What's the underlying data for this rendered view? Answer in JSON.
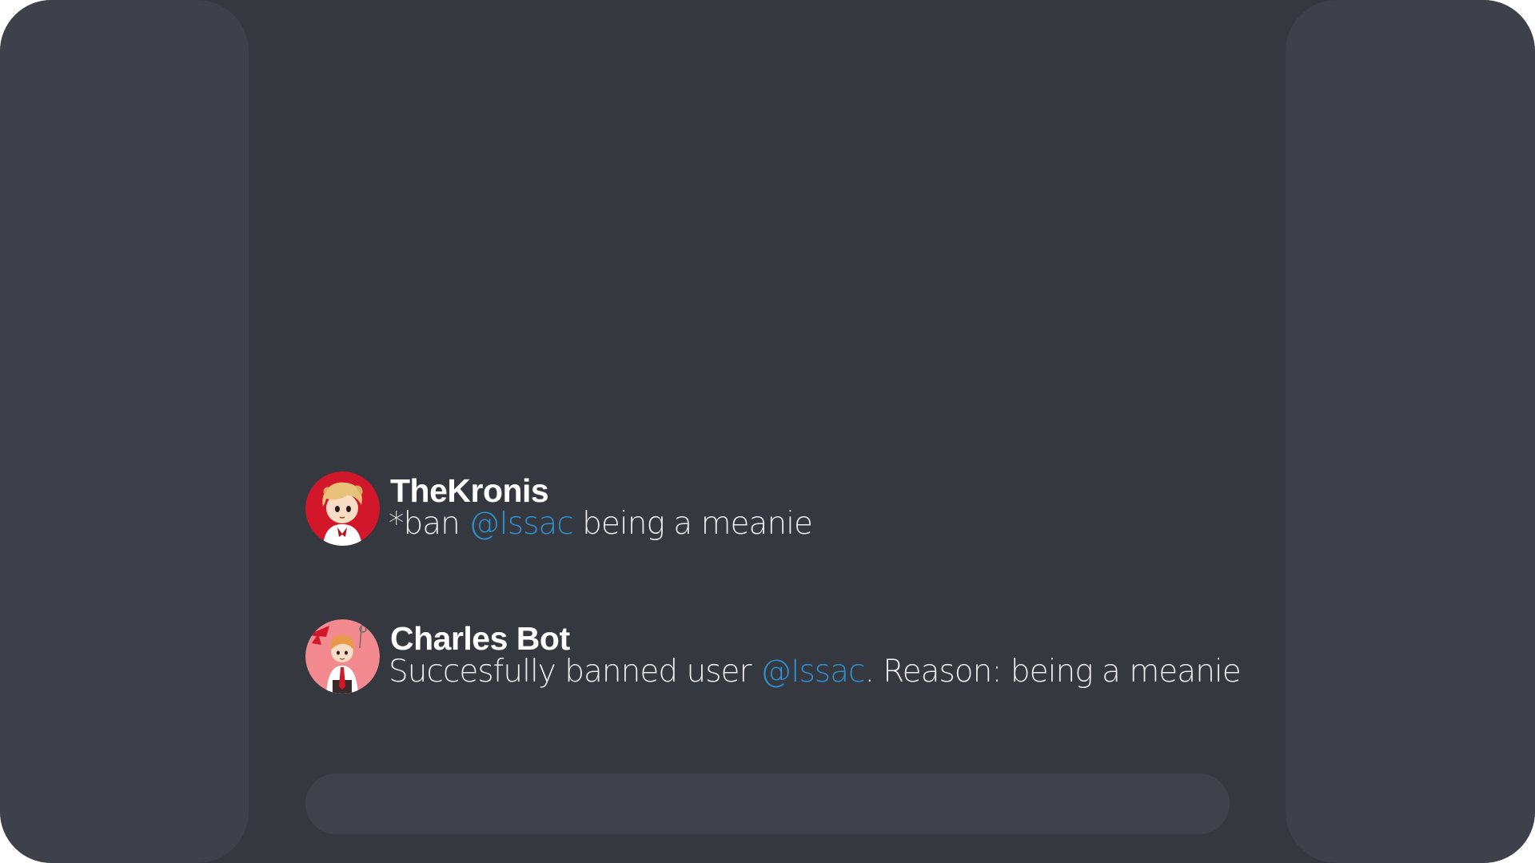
{
  "messages": [
    {
      "author": "TheKronis",
      "text_before": "*ban ",
      "mention": "@Issac",
      "text_after": " being a meanie",
      "avatar_icon": "chibi-blond-character-avatar-icon",
      "avatar_bg": "#d3172a"
    },
    {
      "author": "Charles Bot",
      "text_before": "Succesfully banned user ",
      "mention": "@Issac",
      "text_after": ". Reason: being a meanie",
      "avatar_icon": "chibi-red-tie-character-avatar-icon",
      "avatar_bg": "#f28a8f"
    }
  ],
  "composer": {
    "value": "",
    "placeholder": ""
  },
  "colors": {
    "background": "#36383f",
    "sidebar": "#3e4149",
    "composer": "#3f424a",
    "mention": "#2d8fd0",
    "username": "#ffffff",
    "text": "#ececee"
  }
}
